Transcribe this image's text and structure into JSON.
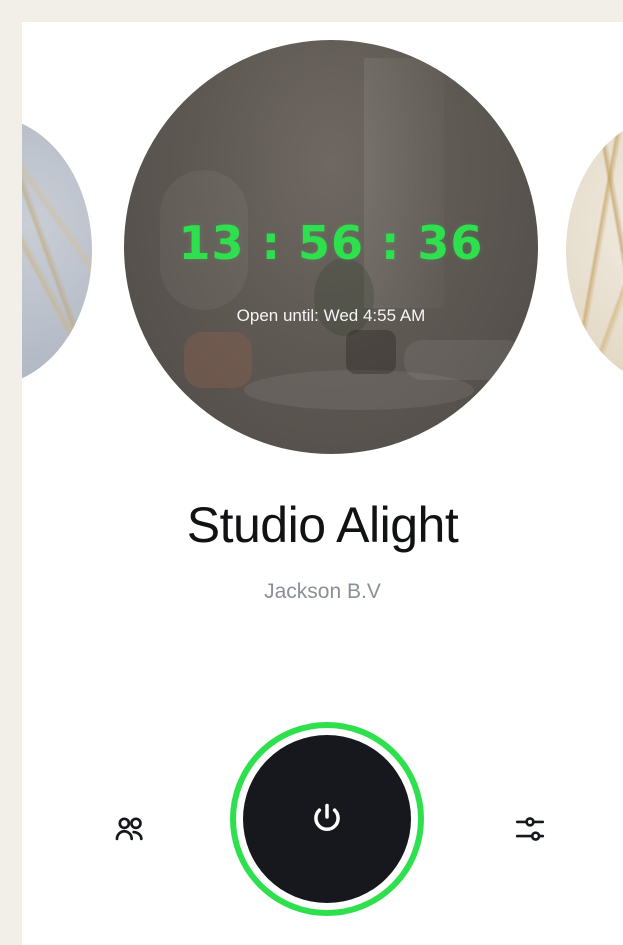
{
  "carousel": {
    "timer": "13 : 56 : 36",
    "open_until": "Open until: Wed 4:55 AM"
  },
  "studio": {
    "name": "Studio Alight",
    "owner": "Jackson B.V"
  },
  "icons": {
    "users": "users-icon",
    "power": "power-icon",
    "settings": "sliders-icon"
  },
  "colors": {
    "accent": "#2fe04e",
    "power_bg": "#16181d",
    "title": "#111214",
    "subtitle": "#8a9098"
  }
}
